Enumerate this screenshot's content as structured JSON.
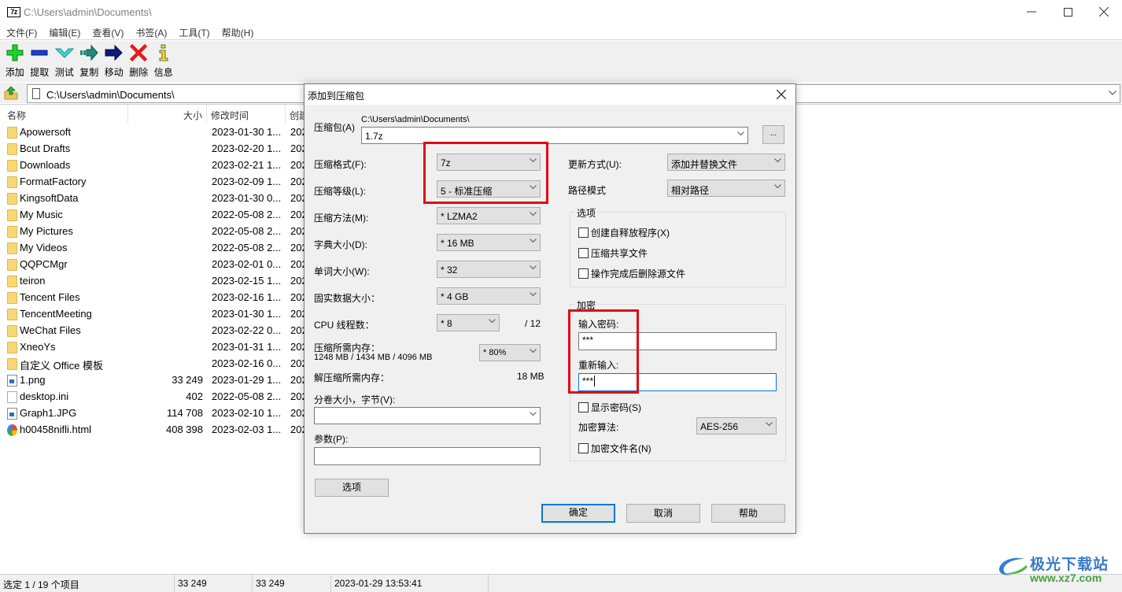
{
  "window": {
    "app_logo": "7z",
    "title": "C:\\Users\\admin\\Documents\\",
    "controls": {
      "minimize": "—",
      "maximize": "☐",
      "close": "✕"
    }
  },
  "menu": [
    "文件(F)",
    "编辑(E)",
    "查看(V)",
    "书签(A)",
    "工具(T)",
    "帮助(H)"
  ],
  "toolbar": [
    {
      "label": "添加",
      "icon": "add-icon"
    },
    {
      "label": "提取",
      "icon": "extract-icon"
    },
    {
      "label": "测试",
      "icon": "test-icon"
    },
    {
      "label": "复制",
      "icon": "copy-icon"
    },
    {
      "label": "移动",
      "icon": "move-icon"
    },
    {
      "label": "删除",
      "icon": "delete-icon"
    },
    {
      "label": "信息",
      "icon": "info-icon"
    }
  ],
  "address": {
    "path": "C:\\Users\\admin\\Documents\\"
  },
  "filelist": {
    "columns": {
      "name": "名称",
      "size": "大小",
      "modified": "修改时间",
      "created": "创建"
    },
    "rows": [
      {
        "type": "folder",
        "name": "Apowersoft",
        "size": "",
        "modified": "2023-01-30 1...",
        "created": "202"
      },
      {
        "type": "folder",
        "name": "Bcut Drafts",
        "size": "",
        "modified": "2023-02-20 1...",
        "created": "202"
      },
      {
        "type": "folder",
        "name": "Downloads",
        "size": "",
        "modified": "2023-02-21 1...",
        "created": "202"
      },
      {
        "type": "folder",
        "name": "FormatFactory",
        "size": "",
        "modified": "2023-02-09 1...",
        "created": "202"
      },
      {
        "type": "folder",
        "name": "KingsoftData",
        "size": "",
        "modified": "2023-01-30 0...",
        "created": "202"
      },
      {
        "type": "folder",
        "name": "My Music",
        "size": "",
        "modified": "2022-05-08 2...",
        "created": "202"
      },
      {
        "type": "folder",
        "name": "My Pictures",
        "size": "",
        "modified": "2022-05-08 2...",
        "created": "202"
      },
      {
        "type": "folder",
        "name": "My Videos",
        "size": "",
        "modified": "2022-05-08 2...",
        "created": "202"
      },
      {
        "type": "folder",
        "name": "QQPCMgr",
        "size": "",
        "modified": "2023-02-01 0...",
        "created": "202"
      },
      {
        "type": "folder",
        "name": "teiron",
        "size": "",
        "modified": "2023-02-15 1...",
        "created": "202"
      },
      {
        "type": "folder",
        "name": "Tencent Files",
        "size": "",
        "modified": "2023-02-16 1...",
        "created": "202"
      },
      {
        "type": "folder",
        "name": "TencentMeeting",
        "size": "",
        "modified": "2023-01-30 1...",
        "created": "202"
      },
      {
        "type": "folder",
        "name": "WeChat Files",
        "size": "",
        "modified": "2023-02-22 0...",
        "created": "202"
      },
      {
        "type": "folder",
        "name": "XneoYs",
        "size": "",
        "modified": "2023-01-31 1...",
        "created": "202"
      },
      {
        "type": "folder",
        "name": "自定义 Office 模板",
        "size": "",
        "modified": "2023-02-16 0...",
        "created": "202"
      },
      {
        "type": "image",
        "name": "1.png",
        "size": "33 249",
        "modified": "2023-01-29 1...",
        "created": "202"
      },
      {
        "type": "ini",
        "name": "desktop.ini",
        "size": "402",
        "modified": "2022-05-08 2...",
        "created": "202"
      },
      {
        "type": "image",
        "name": "Graph1.JPG",
        "size": "114 708",
        "modified": "2023-02-10 1...",
        "created": "202"
      },
      {
        "type": "html",
        "name": "h00458nifli.html",
        "size": "408 398",
        "modified": "2023-02-03 1...",
        "created": "202"
      }
    ]
  },
  "statusbar": {
    "selection": "选定 1 / 19 个项目",
    "size": "33 249",
    "packed": "33 249",
    "modified": "2023-01-29 13:53:41"
  },
  "watermark": {
    "title": "极光下载站",
    "url": "www.xz7.com"
  },
  "dialog": {
    "title": "添加到压缩包",
    "close": "✕",
    "archive": {
      "label": "压缩包(A)",
      "dir": "C:\\Users\\admin\\Documents\\",
      "value": "1.7z",
      "browse": "..."
    },
    "format": {
      "label": "压缩格式(F):",
      "value": "7z"
    },
    "level": {
      "label": "压缩等级(L):",
      "value": "5 - 标准压缩"
    },
    "method": {
      "label": "压缩方法(M):",
      "value": "* LZMA2"
    },
    "dict": {
      "label": "字典大小(D):",
      "value": "* 16 MB"
    },
    "word": {
      "label": "单词大小(W):",
      "value": "* 32"
    },
    "solid": {
      "label": "固实数据大小：",
      "value": "* 4 GB"
    },
    "threads": {
      "label": "CPU 线程数：",
      "value": "* 8",
      "max": "/ 12"
    },
    "mem_compress": {
      "label": "压缩所需内存：",
      "detail": "1248 MB / 1434 MB / 4096 MB",
      "value": "* 80%"
    },
    "mem_decompress": {
      "label": "解压缩所需内存：",
      "value": "18 MB"
    },
    "split": {
      "label": "分卷大小，字节(V):",
      "value": ""
    },
    "params": {
      "label": "参数(P):",
      "value": ""
    },
    "options_button": "选项",
    "update": {
      "label": "更新方式(U):",
      "value": "添加并替换文件"
    },
    "pathmode": {
      "label": "路径模式",
      "value": "相对路径"
    },
    "options_group": {
      "title": "选项",
      "items": [
        {
          "label": "创建自释放程序(X)",
          "checked": false
        },
        {
          "label": "压缩共享文件",
          "checked": false
        },
        {
          "label": "操作完成后删除源文件",
          "checked": false
        }
      ]
    },
    "encryption": {
      "title": "加密",
      "password_label": "输入密码:",
      "password_value": "***",
      "reenter_label": "重新输入:",
      "reenter_value": "***",
      "show_password": "显示密码(S)",
      "method_label": "加密算法:",
      "method_value": "AES-256",
      "encrypt_names": "加密文件名(N)"
    },
    "buttons": {
      "ok": "确定",
      "cancel": "取消",
      "help": "帮助"
    },
    "highlight_color": "#e00b16"
  }
}
